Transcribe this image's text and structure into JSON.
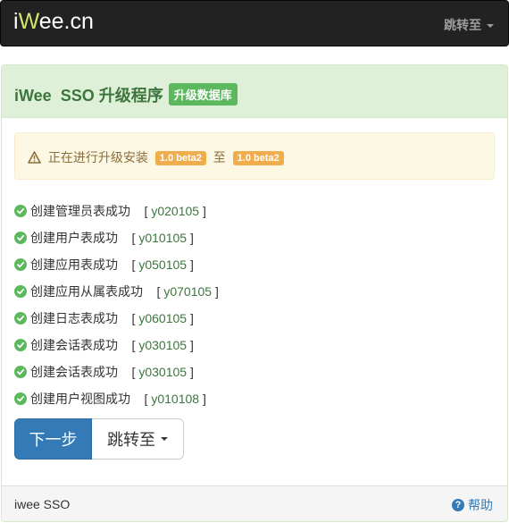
{
  "navbar": {
    "brand_prefix": "i",
    "brand_w": "W",
    "brand_suffix": "ee.cn",
    "jump_label": "跳转至"
  },
  "panel": {
    "title": "iWee  SSO 升级程序",
    "badge": "升级数据库"
  },
  "alert": {
    "text_before": "正在进行升级安装",
    "from_version": "1.0 beta2",
    "connector": "至",
    "to_version": "1.0 beta2"
  },
  "steps": [
    {
      "text": "创建管理员表成功",
      "code": "y020105"
    },
    {
      "text": "创建用户表成功",
      "code": "y010105"
    },
    {
      "text": "创建应用表成功",
      "code": "y050105"
    },
    {
      "text": "创建应用从属表成功",
      "code": "y070105"
    },
    {
      "text": "创建日志表成功",
      "code": "y060105"
    },
    {
      "text": "创建会话表成功",
      "code": "y030105"
    },
    {
      "text": "创建会话表成功",
      "code": "y030105"
    },
    {
      "text": "创建用户视图成功",
      "code": "y010108"
    }
  ],
  "buttons": {
    "next": "下一步",
    "jump": "跳转至"
  },
  "footer": {
    "left_text": "iwee SSO",
    "help": "帮助"
  },
  "colors": {
    "navbar_bg": "#222222",
    "success": "#5cb85c",
    "warning": "#f0ad4e",
    "primary": "#337ab7"
  },
  "icons": {
    "alert": "warning-triangle-icon",
    "step": "check-circle-icon",
    "help": "question-circle-icon"
  }
}
